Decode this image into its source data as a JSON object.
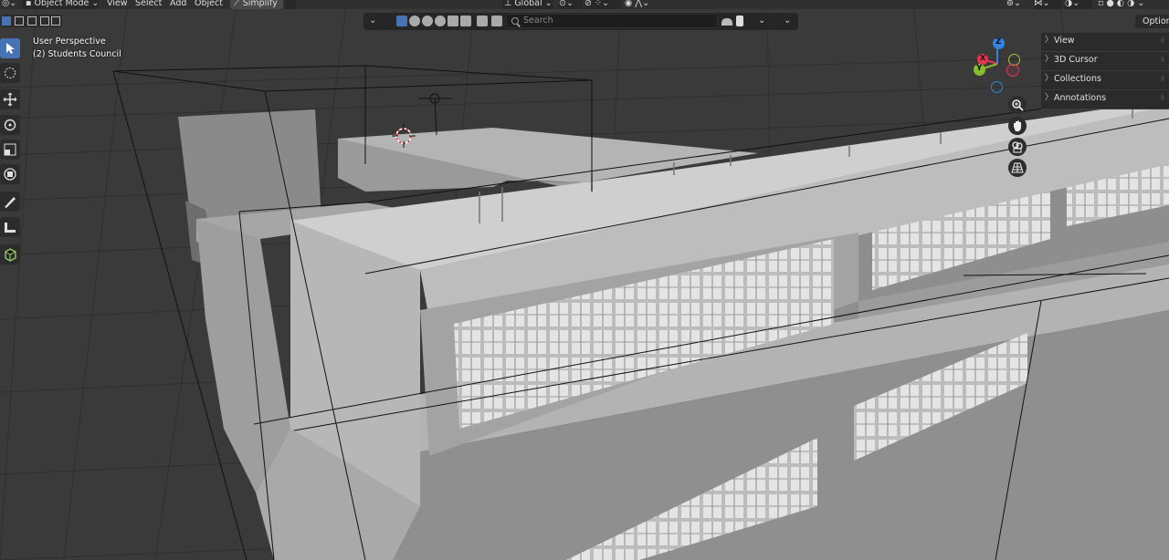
{
  "header": {
    "mode": "Object Mode",
    "menu": [
      "View",
      "Select",
      "Add",
      "Object"
    ],
    "simplify": "Simplify",
    "transform_orientation": "Global"
  },
  "toolbar2": {
    "search_placeholder": "Search"
  },
  "viewport": {
    "perspective": "User Perspective",
    "collection_label": "(2) Students Council"
  },
  "npanel": {
    "options": "Options",
    "items": [
      "View",
      "3D Cursor",
      "Collections",
      "Annotations"
    ]
  },
  "gizmo": {
    "z_label": "Z",
    "x_label": "X",
    "y_label": "Y",
    "colors": {
      "x": "#e5344f",
      "y": "#86bd2a",
      "z": "#2f83e3"
    }
  },
  "icons": {
    "tools": [
      "select-box-icon",
      "cursor-icon",
      "move-icon",
      "rotate-icon",
      "scale-icon",
      "transform-icon",
      "annotate-icon",
      "measure-icon",
      "add-cube-icon"
    ],
    "nav": [
      "zoom-icon",
      "pan-hand-icon",
      "camera-icon",
      "perspective-grid-icon"
    ]
  }
}
